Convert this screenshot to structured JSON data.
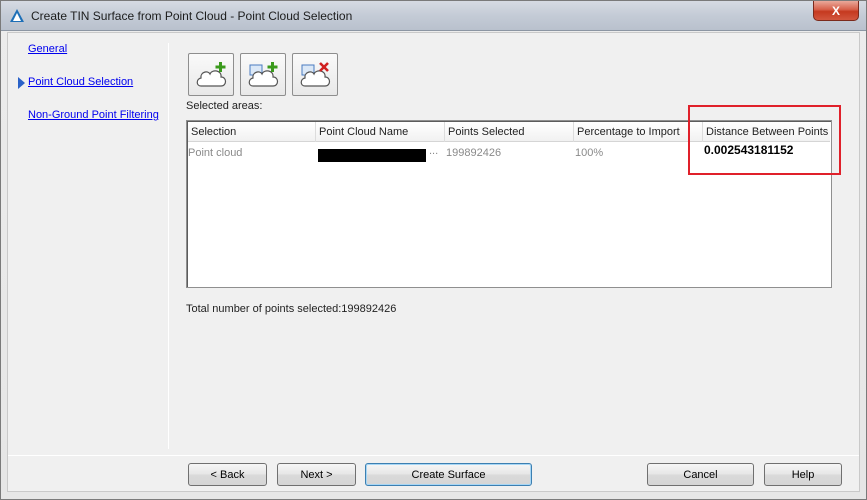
{
  "window": {
    "title": "Create TIN Surface from Point Cloud - Point Cloud Selection",
    "close_glyph": "X"
  },
  "nav": {
    "items": [
      {
        "label": "General",
        "active": false
      },
      {
        "label": "Point Cloud Selection",
        "active": true
      },
      {
        "label": "Non-Ground Point Filtering",
        "active": false
      }
    ]
  },
  "toolbar": {
    "buttons": [
      {
        "icon": "add-point-cloud-icon"
      },
      {
        "icon": "add-area-icon"
      },
      {
        "icon": "remove-area-icon"
      }
    ]
  },
  "selected_areas_label": "Selected areas:",
  "table": {
    "headers": [
      "Selection",
      "Point Cloud Name",
      "Points Selected",
      "Percentage to Import",
      "Distance Between Points"
    ],
    "rows": [
      {
        "selection": "Point cloud",
        "name": "",
        "name_ellipsis": "...",
        "points_selected": "199892426",
        "percentage": "100%",
        "distance": "0.002543181152"
      }
    ]
  },
  "total_text": "Total number of points selected:199892426",
  "buttons": {
    "back": "< Back",
    "next": "Next >",
    "create": "Create Surface",
    "cancel": "Cancel",
    "help": "Help"
  },
  "colors": {
    "link": "#0000ee",
    "highlight": "#e0202a",
    "close": "#c5391f"
  }
}
